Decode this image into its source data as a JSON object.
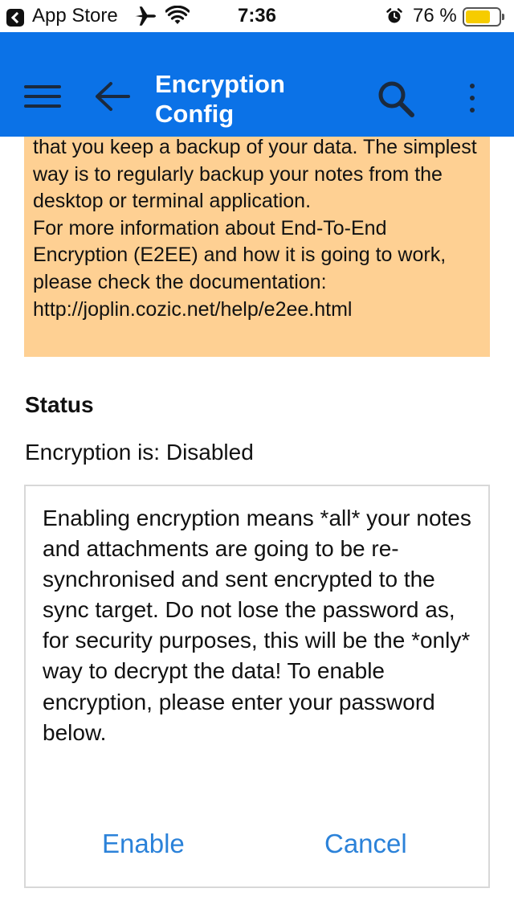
{
  "status_bar": {
    "back_app": "App Store",
    "time": "7:36",
    "battery_percent": "76 %",
    "battery_level": 0.76,
    "battery_color": "#f6cc00",
    "icons": [
      "back-chevron-icon",
      "airplane-icon",
      "wifi-icon",
      "alarm-icon",
      "battery-icon"
    ]
  },
  "header": {
    "title": "Encryption Config",
    "background_color": "#0b72e7",
    "icons": [
      "hamburger-menu-icon",
      "back-arrow-icon",
      "search-icon",
      "more-vertical-icon"
    ]
  },
  "warning": {
    "background_color": "#fed093",
    "text": "that you keep a backup of your data. The simplest way is to regularly backup your notes from the desktop or terminal application.\nFor more information about End-To-End Encryption (E2EE) and how it is going to work, please check the documentation: http://joplin.cozic.net/help/e2ee.html"
  },
  "status": {
    "heading": "Status",
    "encryption_state": "Encryption is: Disabled"
  },
  "enable_dialog": {
    "message": "Enabling encryption means *all* your notes and attachments are going to be re-synchronised and sent encrypted to the sync target. Do not lose the password as, for security purposes, this will be the *only* way to decrypt the data! To enable encryption, please enter your password below.",
    "enable_label": "Enable",
    "cancel_label": "Cancel",
    "button_color": "#2b82d9"
  }
}
